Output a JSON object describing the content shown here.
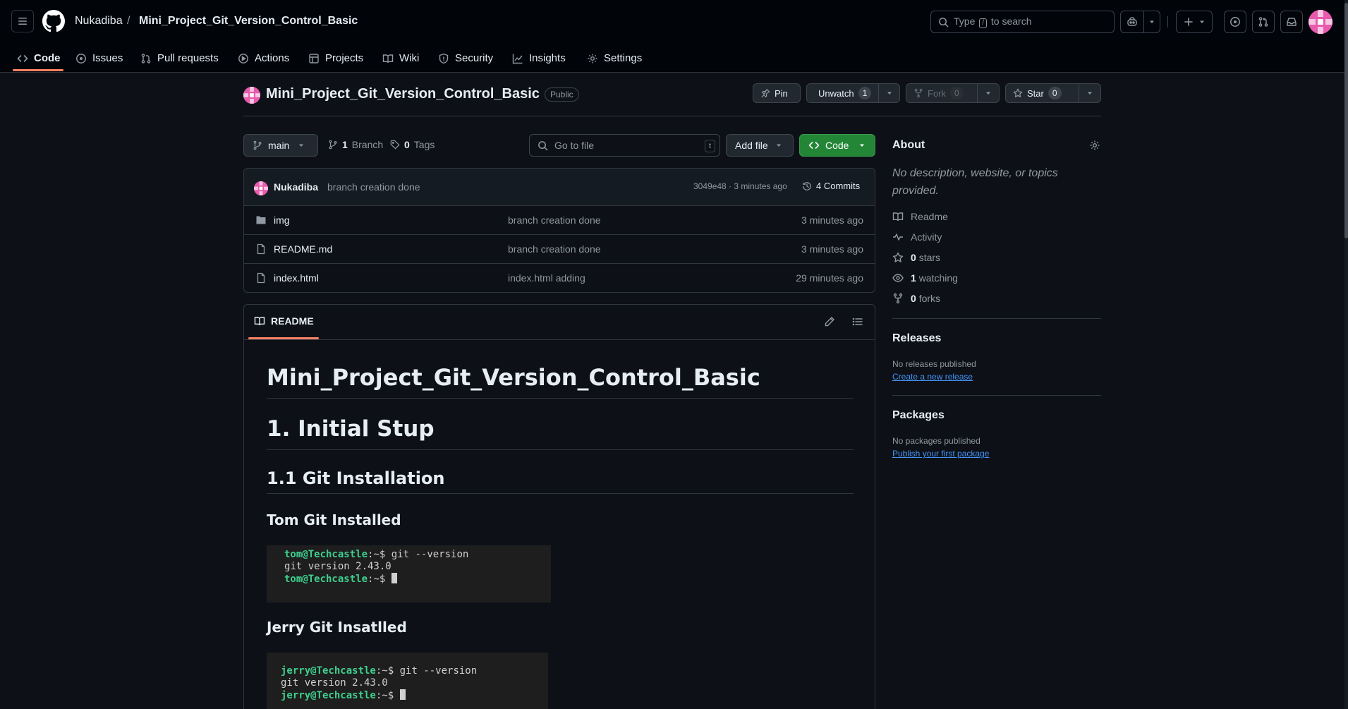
{
  "header": {
    "owner": "Nukadiba",
    "separator": "/",
    "repo": "Mini_Project_Git_Version_Control_Basic",
    "search_prefix": "Type",
    "search_key": "/",
    "search_suffix": "to search"
  },
  "tabs": [
    {
      "label": "Code",
      "icon": "code-icon"
    },
    {
      "label": "Issues",
      "icon": "issue-icon"
    },
    {
      "label": "Pull requests",
      "icon": "pull-request-icon"
    },
    {
      "label": "Actions",
      "icon": "play-icon"
    },
    {
      "label": "Projects",
      "icon": "table-icon"
    },
    {
      "label": "Wiki",
      "icon": "book-icon"
    },
    {
      "label": "Security",
      "icon": "shield-icon"
    },
    {
      "label": "Insights",
      "icon": "graph-icon"
    },
    {
      "label": "Settings",
      "icon": "gear-icon"
    }
  ],
  "repo_header": {
    "name": "Mini_Project_Git_Version_Control_Basic",
    "visibility": "Public",
    "pin_label": "Pin",
    "unwatch_label": "Unwatch",
    "watch_count": "1",
    "fork_label": "Fork",
    "fork_count": "0",
    "star_label": "Star",
    "star_count": "0"
  },
  "toolbar": {
    "branch": "main",
    "branches_count": "1",
    "branches_label": "Branch",
    "tags_count": "0",
    "tags_label": "Tags",
    "goto_placeholder": "Go to file",
    "goto_key": "t",
    "add_file": "Add file",
    "code": "Code"
  },
  "latest_commit": {
    "author": "Nukadiba",
    "message": "branch creation done",
    "meta": "3049e48 · 3 minutes ago",
    "commits_label": "4 Commits"
  },
  "files": [
    {
      "name": "img",
      "type": "folder",
      "message": "branch creation done",
      "age": "3 minutes ago"
    },
    {
      "name": "README.md",
      "type": "file",
      "message": "branch creation done",
      "age": "3 minutes ago"
    },
    {
      "name": "index.html",
      "type": "file",
      "message": "index.html adding",
      "age": "29 minutes ago"
    }
  ],
  "readme": {
    "tab_label": "README",
    "h1": "Mini_Project_Git_Version_Control_Basic",
    "h1b": "1. Initial Stup",
    "h2": "1.1 Git Installation",
    "h3a": "Tom Git Installed",
    "h3b": "Jerry Git Insatlled",
    "tom_terminal": {
      "prompt": "tom@Techcastle",
      "suffix": ":~$",
      "cmd": " git --version",
      "output": "git version 2.43.0"
    },
    "jerry_terminal": {
      "prompt": "jerry@Techcastle",
      "suffix": ":~$",
      "cmd": " git --version",
      "output": "git version 2.43.0"
    }
  },
  "about": {
    "title": "About",
    "description": "No description, website, or topics provided.",
    "readme": "Readme",
    "activity": "Activity",
    "stars_count": "0",
    "stars_label": "stars",
    "watching_count": "1",
    "watching_label": "watching",
    "forks_count": "0",
    "forks_label": "forks"
  },
  "releases": {
    "title": "Releases",
    "empty": "No releases published",
    "link": "Create a new release"
  },
  "packages": {
    "title": "Packages",
    "empty": "No packages published",
    "link": "Publish your first package"
  },
  "colors": {
    "accent_green": "#238636",
    "underline": "#f78166",
    "link": "#4493f8",
    "terminal_prompt": "#3ecf8e"
  }
}
